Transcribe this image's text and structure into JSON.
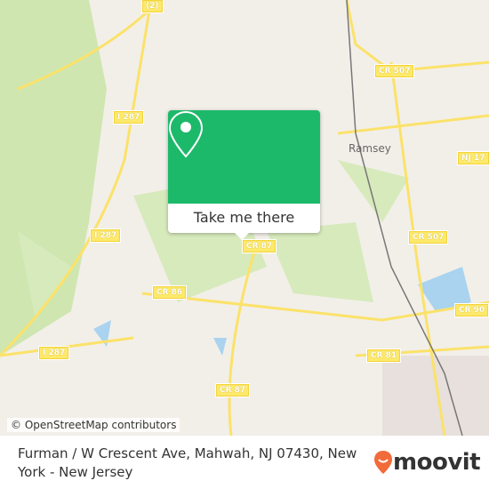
{
  "map": {
    "towns": [
      {
        "name": "Ramsey"
      }
    ],
    "road_labels": [
      "(2)",
      "CR 507",
      "I 287",
      "NJ 17",
      "I 287",
      "CR 87",
      "CR 507",
      "CR 86",
      "CR 90",
      "I 287",
      "CR 81",
      "CR 87"
    ],
    "attribution": "© OpenStreetMap contributors",
    "colors": {
      "land": "#f2efe9",
      "park": "#cfe6b0",
      "water": "#a9d3ef",
      "road": "#fbe26a"
    }
  },
  "popup": {
    "button_label": "Take me there",
    "color": "#1db96a",
    "icon": "map-pin-icon"
  },
  "footer": {
    "address": "Furman / W Crescent Ave, Mahwah, NJ 07430, New York - New Jersey",
    "brand": "moovit",
    "brand_color": "#f26b3a"
  }
}
